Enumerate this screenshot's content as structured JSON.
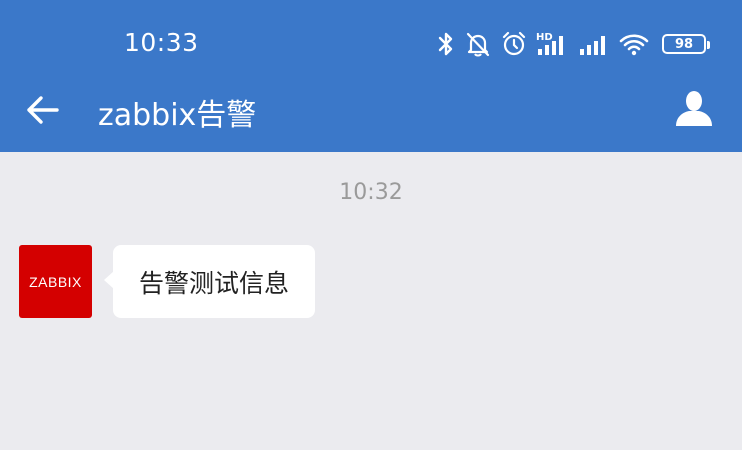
{
  "status_bar": {
    "time": "10:33",
    "icons": [
      "bluetooth-icon",
      "bell-muted-icon",
      "alarm-icon",
      "hd-signal-icon",
      "signal-icon",
      "wifi-icon",
      "battery-icon"
    ],
    "battery_level": "98"
  },
  "nav": {
    "title": "zabbix告警",
    "back_icon": "back-arrow-icon",
    "profile_icon": "person-icon"
  },
  "chat": {
    "timestamp": "10:32",
    "messages": [
      {
        "sender_avatar_text": "ZABBIX",
        "text": "告警测试信息"
      }
    ]
  },
  "colors": {
    "header": "#3b78c9",
    "background": "#ebebef",
    "avatar": "#d40000",
    "bubble": "#ffffff"
  }
}
